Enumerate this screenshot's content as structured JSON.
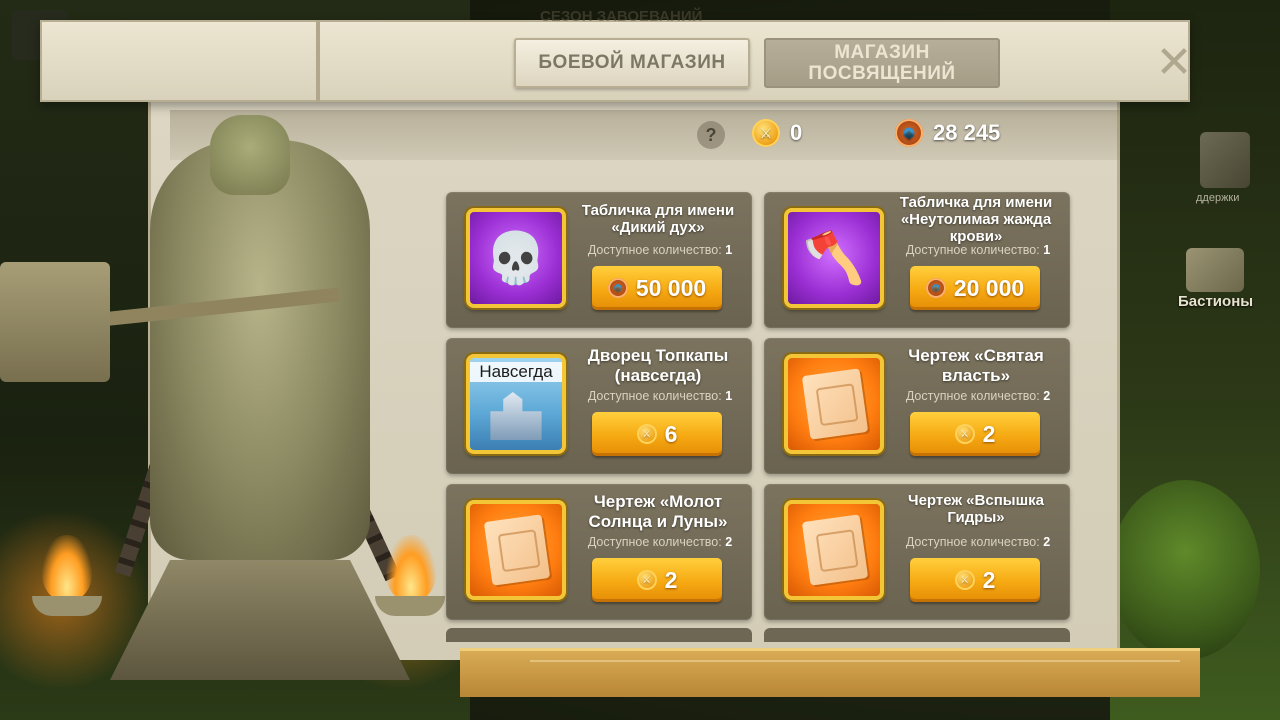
{
  "header": {
    "ghost_title": "СЕЗОН ЗАВОЕВАНИЙ",
    "tabs": [
      {
        "label": "БОЕВОЙ МАГАЗИН",
        "active": true
      },
      {
        "label": "МАГАЗИН ПОСВЯЩЕНИЙ",
        "active": false
      }
    ],
    "close_symbol": "✕"
  },
  "currencies": {
    "help_symbol": "?",
    "swords_icon": "crossed-swords-coin-icon",
    "swords_amount": "0",
    "gems_icon": "gem-coin-icon",
    "gems_amount": "28 245"
  },
  "items": [
    {
      "title": "Табличка для имени «Дикий дух»",
      "quantity_label": "Доступное количество:",
      "quantity": "1",
      "price": "50 000",
      "currency": "gem",
      "frame": "purple",
      "art": "skull-feather-icon"
    },
    {
      "title": "Табличка для имени «Неутолимая жажда крови»",
      "quantity_label": "Доступное количество:",
      "quantity": "1",
      "price": "20 000",
      "currency": "gem",
      "frame": "purple",
      "art": "crossed-axes-icon"
    },
    {
      "title": "Дворец Топкапы (навсегда)",
      "badge": "Навсегда",
      "quantity_label": "Доступное количество:",
      "quantity": "1",
      "price": "6",
      "currency": "swords",
      "frame": "blue",
      "art": "palace-icon"
    },
    {
      "title": "Чертеж «Святая власть»",
      "quantity_label": "Доступное количество:",
      "quantity": "2",
      "price": "2",
      "currency": "swords",
      "frame": "orange",
      "art": "blueprint-sword-icon"
    },
    {
      "title": "Чертеж «Молот Солнца и Луны»",
      "quantity_label": "Доступное количество:",
      "quantity": "2",
      "price": "2",
      "currency": "swords",
      "frame": "orange",
      "art": "blueprint-hammer-icon"
    },
    {
      "title": "Чертеж «Вспышка Гидры»",
      "quantity_label": "Доступное количество:",
      "quantity": "2",
      "price": "2",
      "currency": "swords",
      "frame": "orange",
      "art": "blueprint-crossbow-icon"
    }
  ],
  "side_hud": {
    "label": "Бастионы",
    "label_small": "ддержки"
  },
  "colors": {
    "price_button": "#f6a912",
    "card_bg": "#736b57",
    "item_frame_border": "#f3c638"
  }
}
